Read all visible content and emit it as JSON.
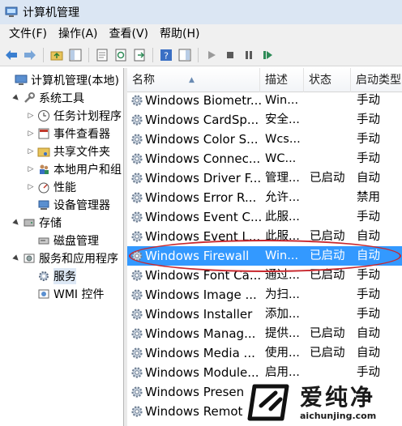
{
  "window": {
    "title": "计算机管理"
  },
  "menu": [
    "文件(F)",
    "操作(A)",
    "查看(V)",
    "帮助(H)"
  ],
  "tree": [
    {
      "label": "计算机管理(本地)",
      "indent": 0,
      "expander": "",
      "icon": "computer-icon"
    },
    {
      "label": "系统工具",
      "indent": 1,
      "expander": "▲",
      "icon": "tools-icon"
    },
    {
      "label": "任务计划程序",
      "indent": 2,
      "expander": "▷",
      "icon": "clock-icon"
    },
    {
      "label": "事件查看器",
      "indent": 2,
      "expander": "▷",
      "icon": "event-viewer-icon"
    },
    {
      "label": "共享文件夹",
      "indent": 2,
      "expander": "▷",
      "icon": "shared-folder-icon"
    },
    {
      "label": "本地用户和组",
      "indent": 2,
      "expander": "▷",
      "icon": "users-icon"
    },
    {
      "label": "性能",
      "indent": 2,
      "expander": "▷",
      "icon": "performance-icon"
    },
    {
      "label": "设备管理器",
      "indent": 2,
      "expander": "",
      "icon": "device-manager-icon"
    },
    {
      "label": "存储",
      "indent": 1,
      "expander": "▲",
      "icon": "storage-icon"
    },
    {
      "label": "磁盘管理",
      "indent": 2,
      "expander": "",
      "icon": "disk-icon"
    },
    {
      "label": "服务和应用程序",
      "indent": 1,
      "expander": "▲",
      "icon": "services-apps-icon"
    },
    {
      "label": "服务",
      "indent": 2,
      "expander": "",
      "icon": "services-icon",
      "selected": true
    },
    {
      "label": "WMI 控件",
      "indent": 2,
      "expander": "",
      "icon": "wmi-icon"
    }
  ],
  "columns": {
    "name": "名称",
    "desc": "描述",
    "status": "状态",
    "startup": "启动类型"
  },
  "services": [
    {
      "name": "Windows Biometr...",
      "desc": "Win...",
      "status": "",
      "startup": "手动"
    },
    {
      "name": "Windows CardSp...",
      "desc": "安全...",
      "status": "",
      "startup": "手动"
    },
    {
      "name": "Windows Color S...",
      "desc": "Wcs...",
      "status": "",
      "startup": "手动"
    },
    {
      "name": "Windows Connec...",
      "desc": "WC...",
      "status": "",
      "startup": "手动"
    },
    {
      "name": "Windows Driver F...",
      "desc": "管理...",
      "status": "已启动",
      "startup": "自动"
    },
    {
      "name": "Windows Error R...",
      "desc": "允许...",
      "status": "",
      "startup": "禁用"
    },
    {
      "name": "Windows Event C...",
      "desc": "此服...",
      "status": "",
      "startup": "手动"
    },
    {
      "name": "Windows Event L...",
      "desc": "此服...",
      "status": "已启动",
      "startup": "自动"
    },
    {
      "name": "Windows Firewall",
      "desc": "Win...",
      "status": "已启动",
      "startup": "自动",
      "selected": true
    },
    {
      "name": "Windows Font Ca...",
      "desc": "通过...",
      "status": "已启动",
      "startup": "手动"
    },
    {
      "name": "Windows Image ...",
      "desc": "为扫...",
      "status": "",
      "startup": "手动"
    },
    {
      "name": "Windows Installer",
      "desc": "添加...",
      "status": "",
      "startup": "手动"
    },
    {
      "name": "Windows Manag...",
      "desc": "提供...",
      "status": "已启动",
      "startup": "自动"
    },
    {
      "name": "Windows Media ...",
      "desc": "使用...",
      "status": "已启动",
      "startup": "自动"
    },
    {
      "name": "Windows Module...",
      "desc": "启用...",
      "status": "",
      "startup": "手动"
    },
    {
      "name": "Windows Presen...",
      "desc": "",
      "status": "",
      "startup": ""
    },
    {
      "name": "Windows Remot...",
      "desc": "",
      "status": "",
      "startup": ""
    }
  ],
  "watermark": {
    "title": "爱纯净",
    "url": "aichunjing.com"
  },
  "colors": {
    "selection": "#3399ff",
    "highlight_oval": "#c8282e",
    "titlebar": "#dbe6f3"
  }
}
